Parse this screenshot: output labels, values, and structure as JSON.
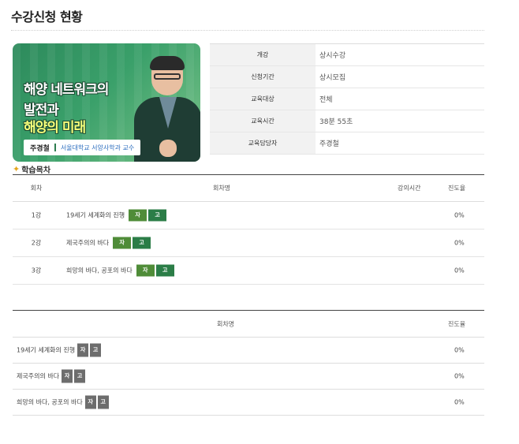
{
  "page": {
    "title": "수강신청 현황"
  },
  "course": {
    "thumbnail": {
      "line1": "해양 네트워크의",
      "line2": "발전과",
      "line3": "해양의 미래",
      "presenter": "주경철",
      "affiliation": "서울대학교 서양사학과 교수"
    },
    "info": [
      {
        "key": "개강",
        "value": "상시수강"
      },
      {
        "key": "신청기간",
        "value": "상시모집"
      },
      {
        "key": "교육대상",
        "value": "전체"
      },
      {
        "key": "교육시간",
        "value": "38분 55초"
      },
      {
        "key": "교육담당자",
        "value": "주경철"
      }
    ]
  },
  "curriculum": {
    "label": "학습목차",
    "headers": {
      "no": "회차",
      "name": "회차명",
      "time": "강의시간",
      "progress": "진도율"
    },
    "badges": {
      "subtitle": "자",
      "high": "고"
    },
    "rows": [
      {
        "no": "1강",
        "name": "19세기 세계화의 진행",
        "progress": "0%"
      },
      {
        "no": "2강",
        "name": "제국주의의 바다",
        "progress": "0%"
      },
      {
        "no": "3강",
        "name": "희망의 바다, 공포의 바다",
        "progress": "0%"
      }
    ]
  },
  "curriculum2": {
    "headers": {
      "name": "회차명",
      "progress": "진도율"
    },
    "badges": {
      "subtitle": "자",
      "high": "고"
    },
    "rows": [
      {
        "name": "19세기 세계화의 진행",
        "progress": "0%"
      },
      {
        "name": "제국주의의 바다",
        "progress": "0%"
      },
      {
        "name": "희망의 바다, 공포의 바다",
        "progress": "0%"
      }
    ]
  },
  "colors": {
    "badge_green_1": "#4f8c38",
    "badge_green_2": "#2b7d47",
    "badge_gray": "#6d6d6d",
    "accent": "#2e7d4f"
  }
}
